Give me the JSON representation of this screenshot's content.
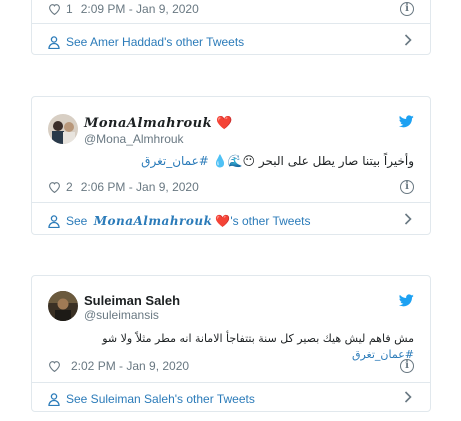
{
  "card1": {
    "like_count": "1",
    "timestamp": "2:09 PM - Jan 9, 2020",
    "see_more": "See Amer Haddad's other Tweets"
  },
  "card2": {
    "display_name": "MonaAlmahrouk",
    "name_emoji": "❤️",
    "handle": "@Mona_Almhrouk",
    "tweet_text": "وأخيراً بيتنا صار يطل على البحر",
    "emojis": "😶🌊💧",
    "hashtag": "#عمان_تغرق",
    "like_count": "2",
    "timestamp": "2:06 PM - Jan 9, 2020",
    "see_more_prefix": "See ",
    "see_more_name": "MonaAlmahrouk",
    "see_more_suffix": "'s other Tweets"
  },
  "card3": {
    "display_name": "Suleiman Saleh",
    "handle": "@suleimansis",
    "tweet_text": "مش فاهم ليش هيك بصير كل سنة بتتفاجأ الامانة انه مطر مثلاً ولا شو",
    "hashtag": "#عمان_تغرق",
    "timestamp": "2:02 PM - Jan 9, 2020",
    "see_more": "See Suleiman Saleh's other Tweets"
  },
  "colors": {
    "link": "#2b7bb9",
    "meta": "#697882",
    "border": "#e1e8ed",
    "twitter_blue": "#1da1f2",
    "heart_red": "#e0245e"
  },
  "icons": [
    "heart-icon",
    "info-icon",
    "person-icon",
    "chevron-right-icon",
    "twitter-bird-icon",
    "avatar"
  ]
}
